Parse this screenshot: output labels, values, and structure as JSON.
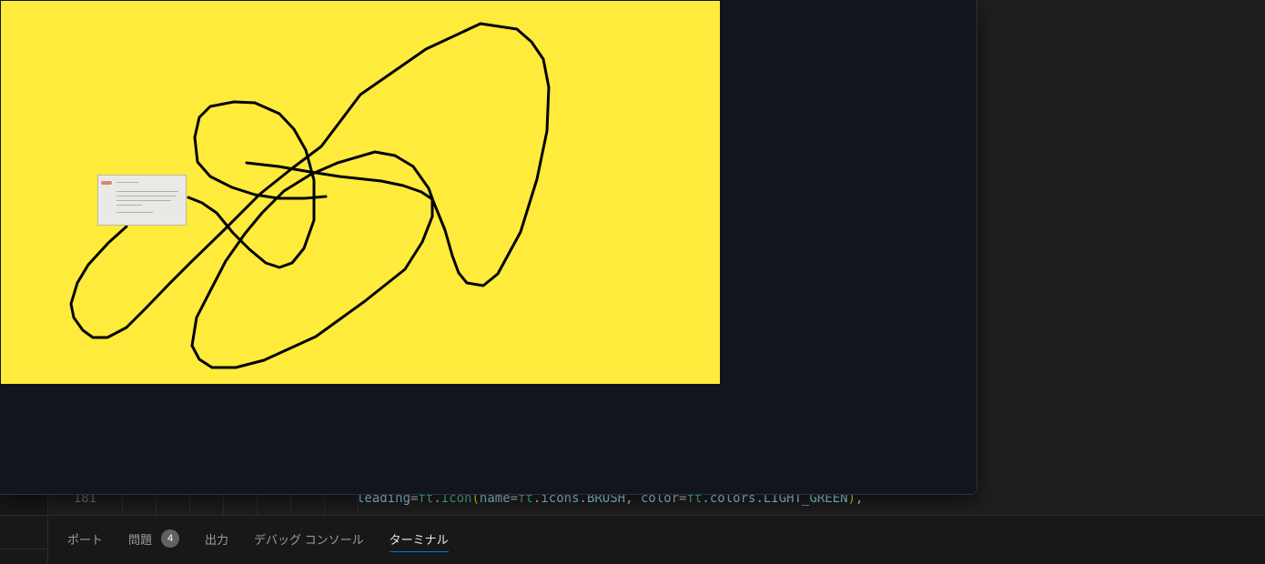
{
  "editor": {
    "line_number": "181",
    "code_tokens": [
      {
        "text": "leading",
        "kind": "ident"
      },
      {
        "text": "=",
        "kind": "punc"
      },
      {
        "text": "ft",
        "kind": "ns"
      },
      {
        "text": ".",
        "kind": "punc"
      },
      {
        "text": "Icon",
        "kind": "ns"
      },
      {
        "text": "(",
        "kind": "paren"
      },
      {
        "text": "name",
        "kind": "ident"
      },
      {
        "text": "=",
        "kind": "punc"
      },
      {
        "text": "ft",
        "kind": "ns"
      },
      {
        "text": ".",
        "kind": "punc"
      },
      {
        "text": "icons",
        "kind": "ident"
      },
      {
        "text": ".",
        "kind": "punc"
      },
      {
        "text": "BRUSH",
        "kind": "ident"
      },
      {
        "text": ", ",
        "kind": "punc"
      },
      {
        "text": "color",
        "kind": "ident"
      },
      {
        "text": "=",
        "kind": "punc"
      },
      {
        "text": "ft",
        "kind": "ns"
      },
      {
        "text": ".",
        "kind": "punc"
      },
      {
        "text": "colors",
        "kind": "ident"
      },
      {
        "text": ".",
        "kind": "punc"
      },
      {
        "text": "LIGHT_GREEN",
        "kind": "ident"
      },
      {
        "text": ")",
        "kind": "paren"
      },
      {
        "text": ",",
        "kind": "punc"
      }
    ]
  },
  "app_window": {
    "canvas_color": "#ffeb3b",
    "stroke_color": "#000000",
    "thumbnail_icon": "screenshot-thumbnail-image"
  },
  "panel": {
    "tabs": [
      {
        "label": "ポート",
        "active": false
      },
      {
        "label": "問題",
        "active": false,
        "badge": "4"
      },
      {
        "label": "出力",
        "active": false
      },
      {
        "label": "デバッグ コンソール",
        "active": false
      },
      {
        "label": "ターミナル",
        "active": true
      }
    ]
  },
  "colors": {
    "editor_bg": "#1f1f1f",
    "window_bg": "#12151b",
    "accent": "#0078d4"
  }
}
